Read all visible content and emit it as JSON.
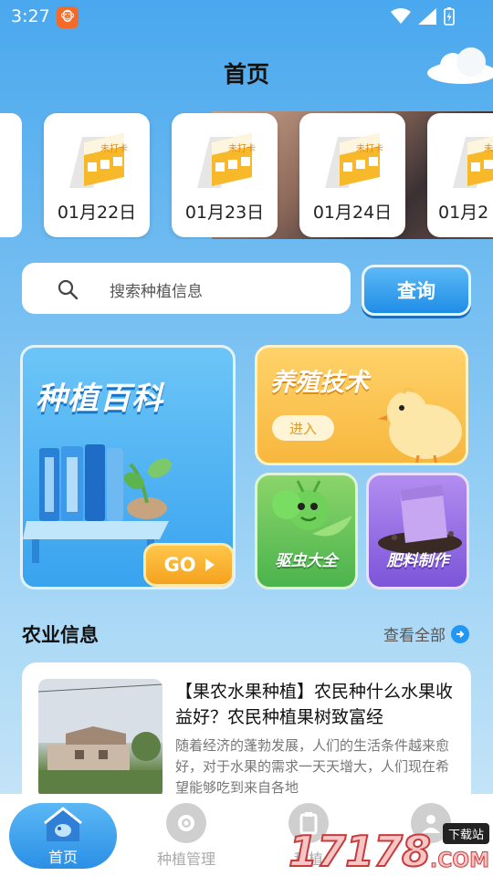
{
  "status_bar": {
    "time": "3:27"
  },
  "header": {
    "title": "首页"
  },
  "date_cards": [
    {
      "label": "01月22日",
      "badge": "未打卡"
    },
    {
      "label": "01月23日",
      "badge": "未打卡"
    },
    {
      "label": "01月24日",
      "badge": "未打卡"
    },
    {
      "label": "01月2",
      "badge": "未打卡"
    }
  ],
  "search": {
    "placeholder": "搜索种植信息",
    "button_label": "查询"
  },
  "features": {
    "encyclopedia": {
      "title": "种植百科",
      "button": "GO"
    },
    "breeding": {
      "title": "养殖技术",
      "button": "进入"
    },
    "pest": {
      "title": "驱虫大全"
    },
    "fertilizer": {
      "title": "肥料制作"
    }
  },
  "agri_info": {
    "title": "农业信息",
    "view_all": "查看全部",
    "articles": [
      {
        "title": "【果农水果种植】农民种什么水果收益好？农民种植果树致富经",
        "excerpt": "随着经济的蓬勃发展，人们的生活条件越来愈好，对于水果的需求一天天增大，人们现在希望能够吃到来自各地"
      }
    ]
  },
  "tabbar": {
    "items": [
      {
        "label": "首页",
        "active": true
      },
      {
        "label": "种植管理",
        "active": false
      },
      {
        "label": "种植",
        "active": false
      },
      {
        "label": "",
        "active": false
      }
    ]
  },
  "watermark": {
    "text": "17178",
    "badge": "下载站",
    "suffix": ".COM"
  },
  "colors": {
    "primary": "#2196f3",
    "go_orange": "#f4a21e",
    "breeding_yellow": "#f7b73e",
    "pest_green": "#4cb34d",
    "fertilizer_purple": "#7c55d9"
  }
}
